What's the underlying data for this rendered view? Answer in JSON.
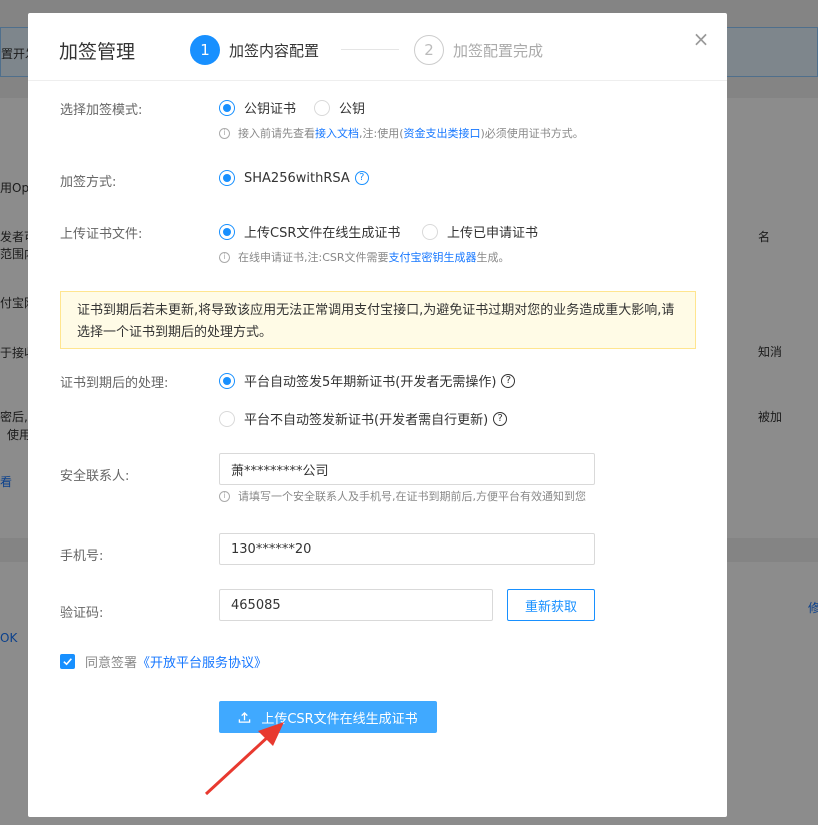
{
  "background": {
    "banner_text": "置开发",
    "fragments": [
      "用Ope",
      "发者可",
      "范围内",
      "付宝网",
      "于接收",
      "密后,",
      "使用",
      "名",
      "知消",
      "被加",
      "修",
      "OK",
      "看"
    ]
  },
  "modal": {
    "title": "加签管理",
    "steps": [
      {
        "number": "1",
        "label": "加签内容配置"
      },
      {
        "number": "2",
        "label": "加签配置完成"
      }
    ],
    "close_icon": "×",
    "mode": {
      "label": "选择加签模式:",
      "options": [
        "公钥证书",
        "公钥"
      ],
      "selected": "公钥证书",
      "hint_prefix": "接入前请先查看",
      "hint_link1": "接入文档",
      "hint_mid": ",注:使用(",
      "hint_link2": "资金支出类接口",
      "hint_suffix": ")必须使用证书方式。"
    },
    "sign_method": {
      "label": "加签方式:",
      "option": "SHA256withRSA"
    },
    "upload_cert": {
      "label": "上传证书文件:",
      "options": [
        "上传CSR文件在线生成证书",
        "上传已申请证书"
      ],
      "selected": "上传CSR文件在线生成证书",
      "hint_prefix": "在线申请证书,注:CSR文件需要",
      "hint_link": "支付宝密钥生成器",
      "hint_suffix": "生成。"
    },
    "warning_text": "证书到期后若未更新,将导致该应用无法正常调用支付宝接口,为避免证书过期对您的业务造成重大影响,请选择一个证书到期后的处理方式。",
    "expiry": {
      "label": "证书到期后的处理:",
      "options": [
        "平台自动签发5年期新证书(开发者无需操作)",
        "平台不自动签发新证书(开发者需自行更新)"
      ],
      "selected": "平台自动签发5年期新证书(开发者无需操作)"
    },
    "contact": {
      "label": "安全联系人:",
      "value": "萧*********公司",
      "hint": "请填写一个安全联系人及手机号,在证书到期前后,方便平台有效通知到您"
    },
    "phone": {
      "label": "手机号:",
      "value": "130******20"
    },
    "code": {
      "label": "验证码:",
      "value": "465085",
      "button": "重新获取"
    },
    "agree": {
      "checked": true,
      "text": "同意签署",
      "link": "《开放平台服务协议》"
    },
    "submit_button": "上传CSR文件在线生成证书"
  },
  "colors": {
    "primary": "#1890ff",
    "arrow": "#e8392f",
    "warning_bg": "#fffbe6"
  }
}
